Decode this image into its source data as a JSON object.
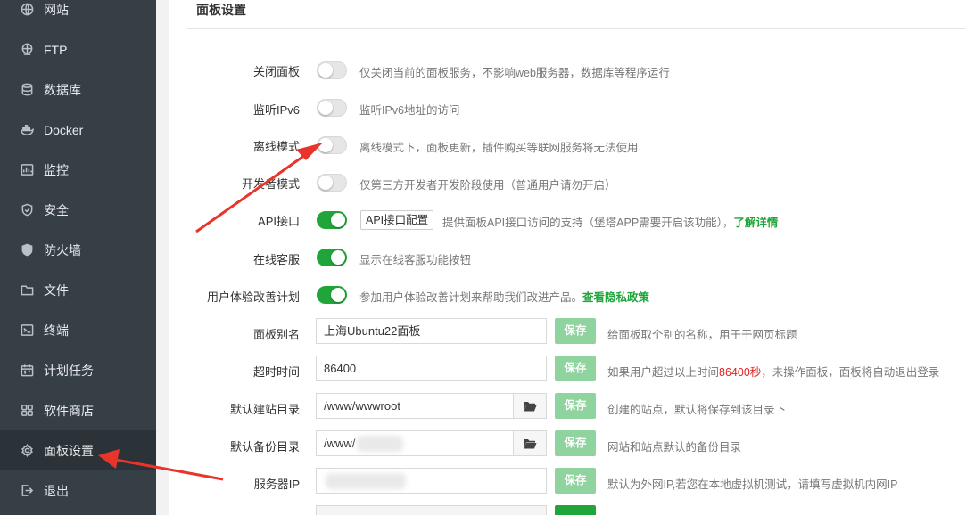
{
  "sidebar": {
    "items": [
      {
        "label": "网站",
        "icon": "globe-icon"
      },
      {
        "label": "FTP",
        "icon": "ftp-globe-icon"
      },
      {
        "label": "数据库",
        "icon": "database-icon"
      },
      {
        "label": "Docker",
        "icon": "docker-icon"
      },
      {
        "label": "监控",
        "icon": "monitor-icon"
      },
      {
        "label": "安全",
        "icon": "shield-icon"
      },
      {
        "label": "防火墙",
        "icon": "firewall-icon"
      },
      {
        "label": "文件",
        "icon": "folder-icon"
      },
      {
        "label": "终端",
        "icon": "terminal-icon"
      },
      {
        "label": "计划任务",
        "icon": "calendar-icon"
      },
      {
        "label": "软件商店",
        "icon": "grid-icon"
      },
      {
        "label": "面板设置",
        "icon": "gear-icon"
      },
      {
        "label": "退出",
        "icon": "logout-icon"
      }
    ],
    "active": "面板设置"
  },
  "panel": {
    "title": "面板设置"
  },
  "toggles": [
    {
      "label": "关闭面板",
      "on": false,
      "hint": "仅关闭当前的面板服务，不影响web服务器，数据库等程序运行"
    },
    {
      "label": "监听IPv6",
      "on": false,
      "hint": "监听IPv6地址的访问"
    },
    {
      "label": "离线模式",
      "on": false,
      "hint": "离线模式下，面板更新，插件购买等联网服务将无法使用"
    },
    {
      "label": "开发者模式",
      "on": false,
      "hint": "仅第三方开发者开发阶段使用（普通用户请勿开启）"
    },
    {
      "label": "API接口",
      "on": true,
      "hint": "提供面板API接口访问的支持（堡塔APP需要开启该功能），",
      "link": "了解详情"
    },
    {
      "label": "在线客服",
      "on": true,
      "hint": "显示在线客服功能按钮"
    },
    {
      "label": "用户体验改善计划",
      "on": true,
      "hint": "参加用户体验改善计划来帮助我们改进产品。",
      "link": "查看隐私政策"
    }
  ],
  "api_config_label": "API接口配置",
  "fields": {
    "alias": {
      "label": "面板别名",
      "value": "上海Ubuntu22面板",
      "save": "保存",
      "hint": "给面板取个别的名称，用于于网页标题"
    },
    "timeout": {
      "label": "超时时间",
      "value": "86400",
      "save": "保存",
      "hint_pre": "如果用户超过以上时间",
      "hint_red": "86400秒",
      "hint_post": "，未操作面板，面板将自动退出登录"
    },
    "site_dir": {
      "label": "默认建站目录",
      "value": "/www/wwwroot",
      "save": "保存",
      "hint": "创建的站点，默认将保存到该目录下"
    },
    "backup_dir": {
      "label": "默认备份目录",
      "value": "/www/",
      "save": "保存",
      "hint": "网站和站点默认的备份目录"
    },
    "server_ip": {
      "label": "服务器IP",
      "value": "",
      "save": "保存",
      "hint": "默认为外网IP,若您在本地虚拟机测试，请填写虚拟机内网IP"
    }
  },
  "colors": {
    "accent": "#20a53a",
    "sidebar": "#363e46",
    "arrow": "#e8342a"
  }
}
